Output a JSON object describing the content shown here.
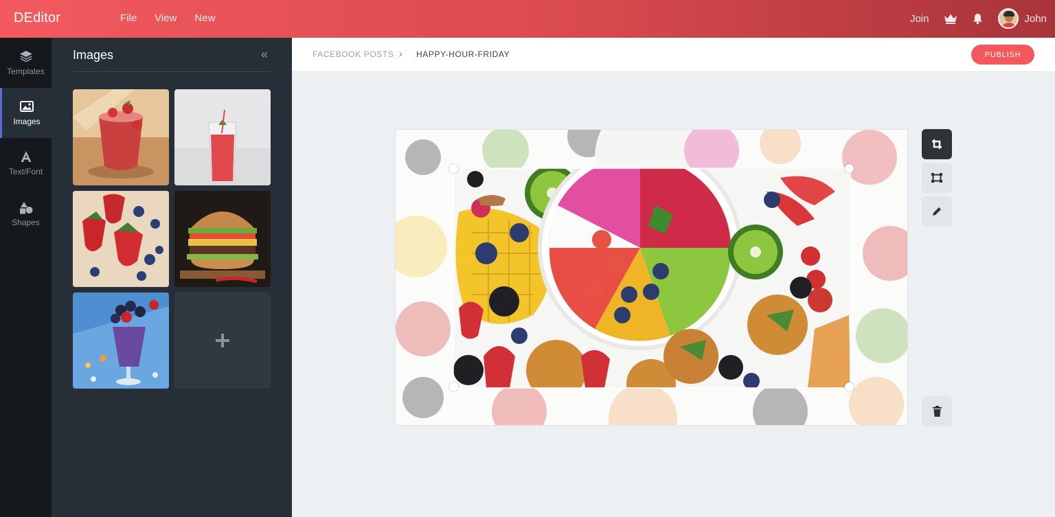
{
  "app": {
    "title": "DEditor"
  },
  "topnav": {
    "file": "File",
    "view": "View",
    "new": "New"
  },
  "user": {
    "join": "Join",
    "name": "John"
  },
  "icons": {
    "crown": "crown-icon",
    "bell": "bell-icon",
    "avatar": "avatar"
  },
  "rail": {
    "items": [
      {
        "label": "Templates",
        "icon": "layers-icon"
      },
      {
        "label": "Images",
        "icon": "image-icon"
      },
      {
        "label": "Text/Font",
        "icon": "text-font-icon"
      },
      {
        "label": "Shapes",
        "icon": "shapes-icon"
      }
    ]
  },
  "panel": {
    "title": "Images",
    "collapse": "«",
    "add_label": "+"
  },
  "breadcrumb": {
    "parent": "FACEBOOK POSTS",
    "separator": "›",
    "current": "HAPPY-HOUR-FRIDAY"
  },
  "actions": {
    "publish": "PUBLISH"
  },
  "tools": [
    "crop-icon",
    "resize-icon",
    "edit-pencil-icon",
    "trash-icon"
  ],
  "colors": {
    "brand": "#f25a5e",
    "publish": "#f3585c",
    "rail_accent": "#5b6bd6"
  }
}
